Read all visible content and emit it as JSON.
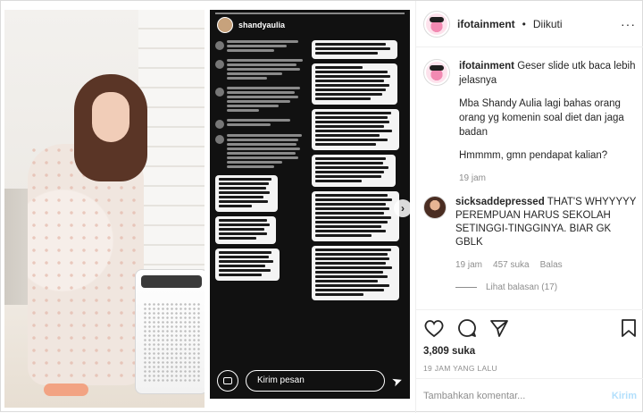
{
  "header": {
    "username": "ifotainment",
    "separator": "•",
    "follow_state": "Diikuti",
    "more": "···"
  },
  "story": {
    "username": "shandyaulia",
    "message_placeholder": "Kirim pesan",
    "next_icon": "chevron-right-icon"
  },
  "post": {
    "username": "ifotainment",
    "caption_first": "Geser slide utk baca lebih jelasnya",
    "caption_second": "Mba Shandy Aulia lagi bahas orang orang yg komenin soal diet dan jaga badan",
    "caption_third": "Hmmmm, gmn pendapat kalian?",
    "time": "19 jam"
  },
  "comments": [
    {
      "username": "sicksaddepressed",
      "text": "THAT'S WHYYYYY PEREMPUAN HARUS SEKOLAH SETINGGI-TINGGINYA. BIAR GK GBLK",
      "time": "19 jam",
      "likes": "457 suka",
      "reply": "Balas",
      "view_replies": "Lihat balasan (17)"
    }
  ],
  "actions": {
    "likes": "3,809 suka",
    "date": "19 JAM YANG LALU"
  },
  "add_comment": {
    "placeholder": "Tambahkan komentar...",
    "submit": "Kirim"
  }
}
